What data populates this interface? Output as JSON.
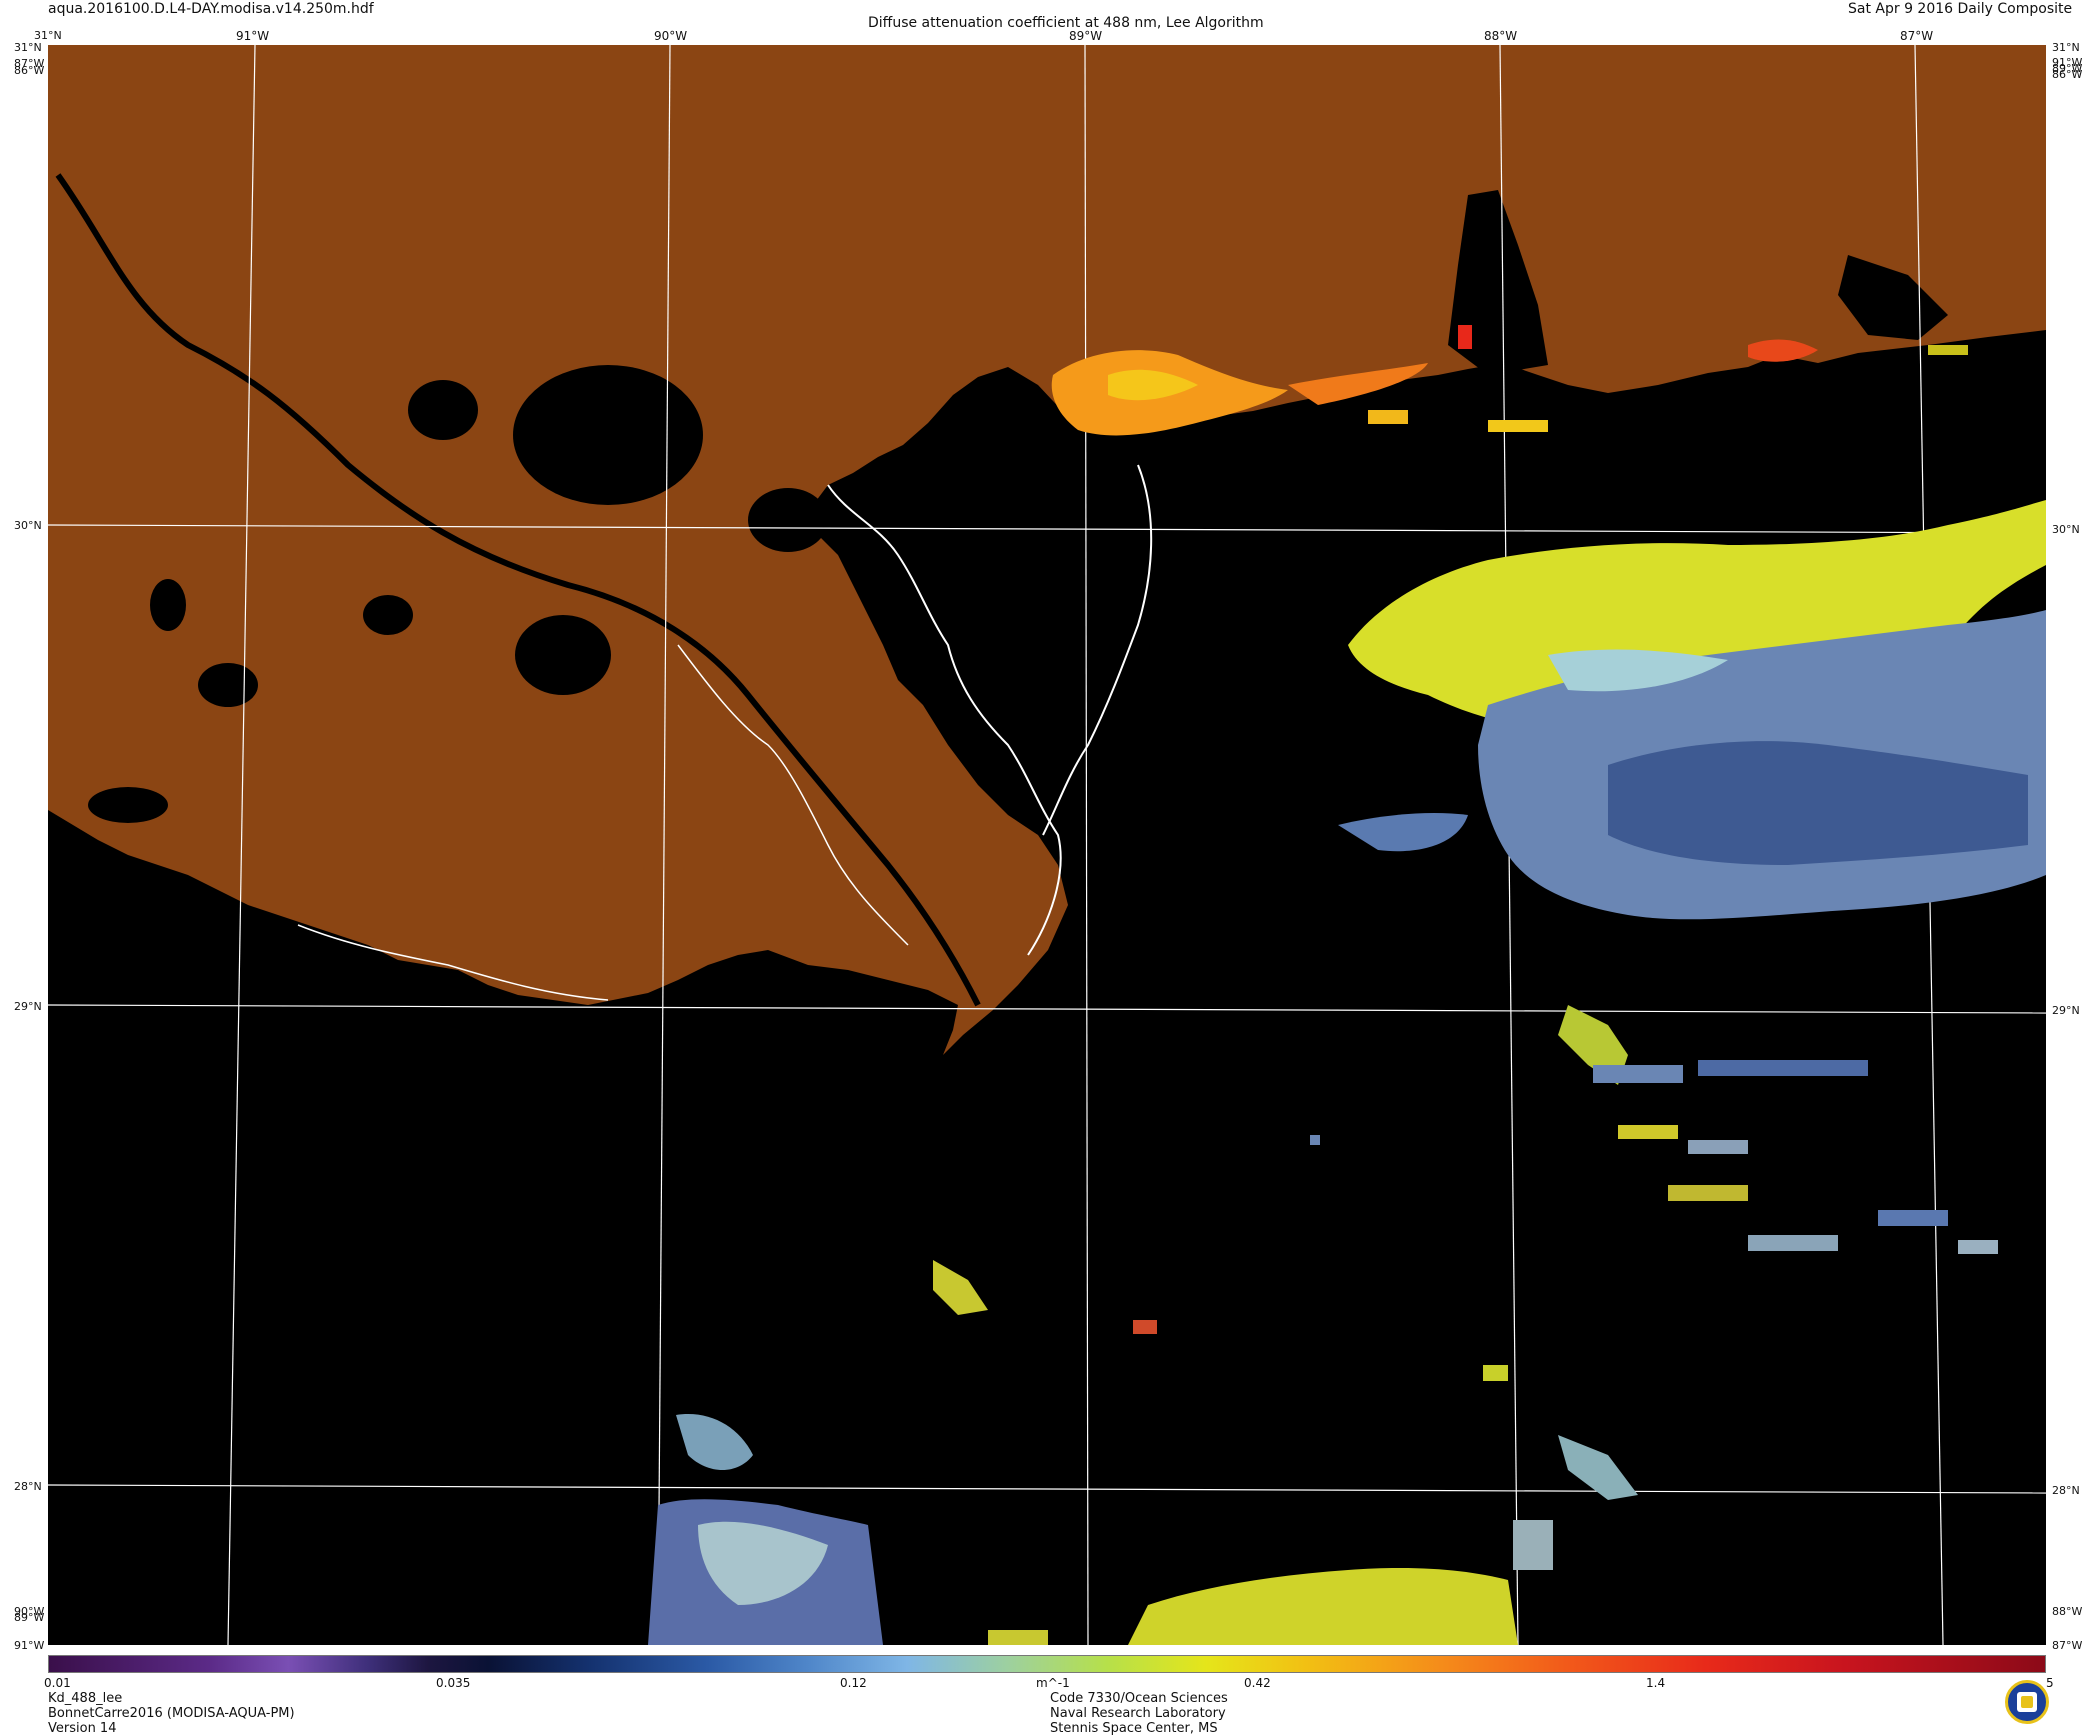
{
  "header": {
    "filename": "aqua.2016100.D.L4-DAY.modisa.v14.250m.hdf",
    "title": "Diffuse attenuation coefficient at 488 nm, Lee Algorithm",
    "date": "Sat Apr  9 2016 Daily Composite"
  },
  "top_labels": {
    "corner_tl": "31°N",
    "lon_91": "91°W",
    "lon_90": "90°W",
    "lon_89": "89°W",
    "lon_88": "88°W",
    "lon_87": "87°W",
    "corner_tr": "31°N"
  },
  "left_labels": {
    "l31": "31°N",
    "l87": "87°W",
    "l86": "86°W",
    "l30": "30°N",
    "l29": "29°N",
    "l28": "28°N",
    "l90w": "90°W",
    "l89w": "89°W",
    "l91w": "91°W"
  },
  "right_labels": {
    "r31": "31°N",
    "r91": "91°W",
    "r89": "89°W",
    "r86": "86°W",
    "r30": "30°N",
    "r29": "29°N",
    "r28": "28°N",
    "r88w": "88°W",
    "r87w": "87°W"
  },
  "colorbar": {
    "ticks": [
      "0.01",
      "0.035",
      "0.12",
      "m^-1",
      "0.42",
      "1.4",
      "5"
    ]
  },
  "footer": {
    "left1": "Kd_488_lee",
    "left2": "BonnetCarre2016 (MODISA-AQUA-PM)",
    "left3": "Version 14",
    "center1": "Code 7330/Ocean Sciences",
    "center2": "Naval Research Laboratory",
    "center3": "Stennis Space Center, MS"
  },
  "colors": {
    "land": "#8B4513",
    "water_nodata": "#000000",
    "grid": "#ffffff",
    "coastline": "#ffffff"
  },
  "logo": {
    "icon": "nrl-seal-icon"
  }
}
